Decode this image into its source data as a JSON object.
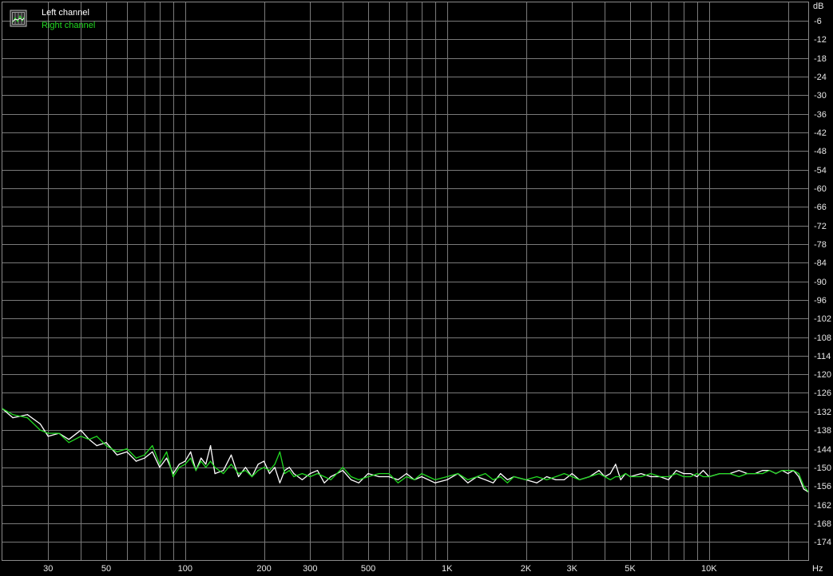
{
  "chart_data": {
    "type": "line",
    "title": "",
    "x_unit": "Hz",
    "y_unit": "dB",
    "x_scale": "log",
    "xlim": [
      20,
      24000
    ],
    "ylim": [
      -180,
      0
    ],
    "grid": true,
    "legend_position": "top-left",
    "x_ticks": [
      {
        "value": 30,
        "label": "30"
      },
      {
        "value": 50,
        "label": "50"
      },
      {
        "value": 100,
        "label": "100"
      },
      {
        "value": 200,
        "label": "200"
      },
      {
        "value": 300,
        "label": "300"
      },
      {
        "value": 500,
        "label": "500"
      },
      {
        "value": 1000,
        "label": "1K"
      },
      {
        "value": 2000,
        "label": "2K"
      },
      {
        "value": 3000,
        "label": "3K"
      },
      {
        "value": 5000,
        "label": "5K"
      },
      {
        "value": 10000,
        "label": "10K"
      }
    ],
    "y_ticks": [
      -6,
      -12,
      -18,
      -24,
      -30,
      -36,
      -42,
      -48,
      -54,
      -60,
      -66,
      -72,
      -78,
      -84,
      -90,
      -96,
      -102,
      -108,
      -114,
      -120,
      -126,
      -132,
      -138,
      -144,
      -150,
      -156,
      -162,
      -168,
      -174
    ],
    "series": [
      {
        "name": "Left channel",
        "color": "#ffffff",
        "x": [
          20,
          22,
          25,
          28,
          30,
          33,
          36,
          40,
          43,
          46,
          50,
          55,
          60,
          65,
          70,
          75,
          80,
          85,
          90,
          95,
          100,
          105,
          110,
          115,
          120,
          125,
          130,
          140,
          150,
          160,
          170,
          180,
          190,
          200,
          210,
          220,
          230,
          240,
          250,
          260,
          280,
          300,
          320,
          340,
          360,
          380,
          400,
          430,
          460,
          500,
          550,
          600,
          650,
          700,
          750,
          800,
          900,
          1000,
          1100,
          1200,
          1300,
          1400,
          1500,
          1600,
          1700,
          1800,
          2000,
          2200,
          2400,
          2600,
          2800,
          3000,
          3200,
          3500,
          3800,
          4000,
          4200,
          4400,
          4600,
          4800,
          5000,
          5500,
          6000,
          6500,
          7000,
          7500,
          8000,
          8500,
          9000,
          9500,
          10000,
          11000,
          12000,
          13000,
          14000,
          15000,
          16000,
          17000,
          18000,
          19000,
          20000,
          21000,
          22000,
          23000,
          24000
        ],
        "y": [
          -131,
          -134,
          -133,
          -136,
          -140,
          -139,
          -141,
          -138,
          -141,
          -143,
          -142,
          -146,
          -145,
          -148,
          -147,
          -145,
          -150,
          -147,
          -152,
          -149,
          -148,
          -145,
          -151,
          -147,
          -149,
          -143,
          -152,
          -151,
          -146,
          -153,
          -150,
          -153,
          -149,
          -148,
          -152,
          -150,
          -155,
          -151,
          -150,
          -152,
          -154,
          -152,
          -151,
          -155,
          -153,
          -152,
          -151,
          -154,
          -155,
          -152,
          -153,
          -153,
          -154,
          -152,
          -154,
          -153,
          -155,
          -154,
          -152,
          -155,
          -153,
          -154,
          -155,
          -152,
          -154,
          -153,
          -154,
          -155,
          -153,
          -154,
          -154,
          -152,
          -154,
          -153,
          -151,
          -153,
          -152,
          -149,
          -154,
          -152,
          -153,
          -152,
          -153,
          -153,
          -154,
          -151,
          -152,
          -152,
          -153,
          -151,
          -153,
          -152,
          -152,
          -151,
          -152,
          -152,
          -151,
          -151,
          -152,
          -151,
          -152,
          -151,
          -153,
          -157,
          -158
        ]
      },
      {
        "name": "Right channel",
        "color": "#22d922",
        "x": [
          20,
          22,
          25,
          28,
          30,
          33,
          36,
          40,
          43,
          46,
          50,
          55,
          60,
          65,
          70,
          75,
          80,
          85,
          90,
          95,
          100,
          105,
          110,
          115,
          120,
          125,
          130,
          140,
          150,
          160,
          170,
          180,
          190,
          200,
          210,
          220,
          230,
          240,
          250,
          260,
          280,
          300,
          320,
          340,
          360,
          380,
          400,
          430,
          460,
          500,
          550,
          600,
          650,
          700,
          750,
          800,
          900,
          1000,
          1100,
          1200,
          1300,
          1400,
          1500,
          1600,
          1700,
          1800,
          2000,
          2200,
          2400,
          2600,
          2800,
          3000,
          3200,
          3500,
          3800,
          4000,
          4200,
          4400,
          4600,
          4800,
          5000,
          5500,
          6000,
          6500,
          7000,
          7500,
          8000,
          8500,
          9000,
          9500,
          10000,
          11000,
          12000,
          13000,
          14000,
          15000,
          16000,
          17000,
          18000,
          19000,
          20000,
          21000,
          22000,
          23000,
          24000
        ],
        "y": [
          -131,
          -133,
          -134,
          -138,
          -139,
          -139,
          -142,
          -140,
          -141,
          -140,
          -143,
          -145,
          -144,
          -147,
          -146,
          -143,
          -149,
          -145,
          -153,
          -150,
          -149,
          -147,
          -151,
          -148,
          -150,
          -148,
          -150,
          -152,
          -149,
          -152,
          -151,
          -153,
          -151,
          -150,
          -151,
          -149,
          -145,
          -152,
          -151,
          -153,
          -152,
          -153,
          -152,
          -153,
          -154,
          -152,
          -150,
          -153,
          -154,
          -153,
          -152,
          -152,
          -155,
          -153,
          -154,
          -152,
          -154,
          -153,
          -152,
          -154,
          -153,
          -152,
          -154,
          -153,
          -155,
          -153,
          -154,
          -153,
          -154,
          -153,
          -152,
          -153,
          -154,
          -153,
          -152,
          -153,
          -154,
          -153,
          -153,
          -152,
          -153,
          -153,
          -152,
          -153,
          -153,
          -152,
          -153,
          -153,
          -152,
          -153,
          -153,
          -152,
          -152,
          -153,
          -152,
          -152,
          -152,
          -151,
          -152,
          -151,
          -151,
          -151,
          -152,
          -156,
          -158
        ]
      }
    ]
  }
}
